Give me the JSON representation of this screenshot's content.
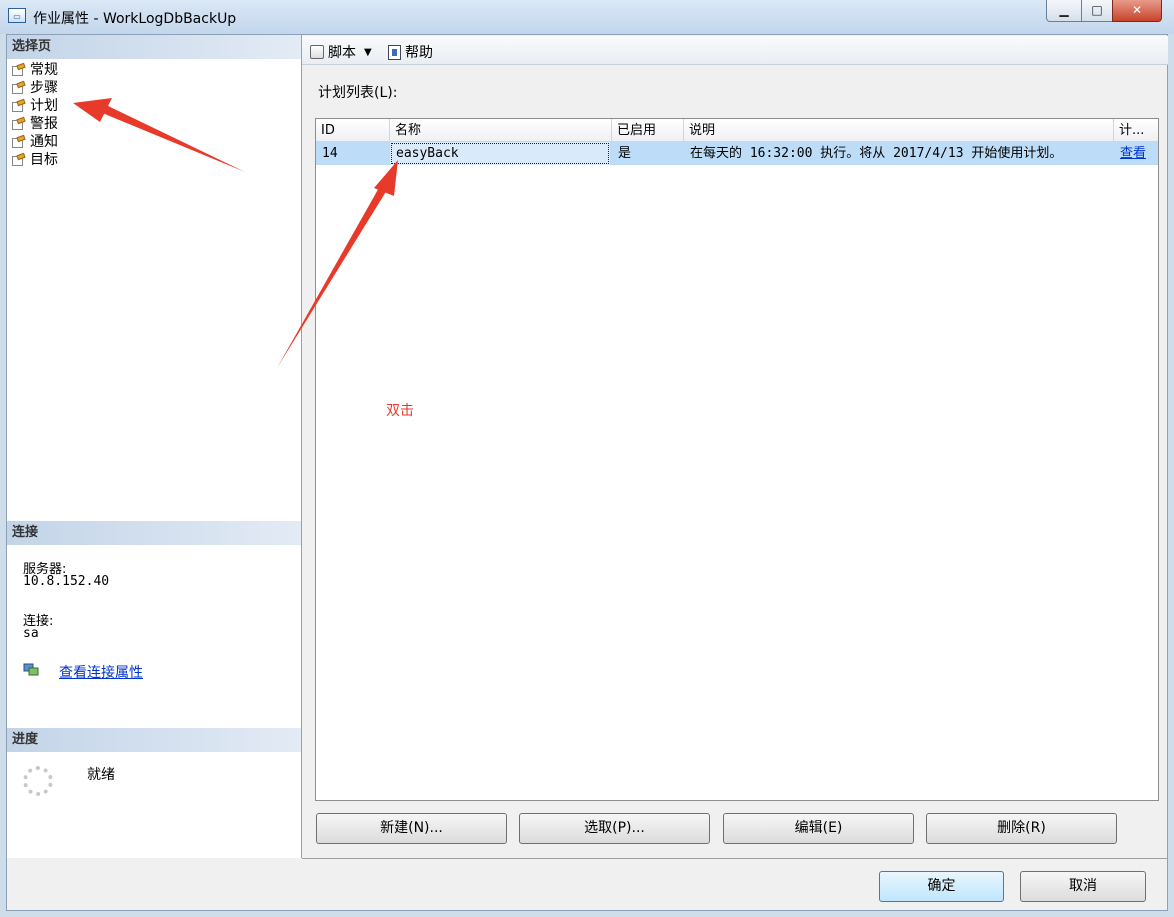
{
  "window": {
    "title": "作业属性 - WorkLogDbBackUp",
    "app_icon": "job-properties-icon"
  },
  "sidebar": {
    "header": "选择页",
    "items": [
      {
        "label": "常规",
        "icon": "page-icon"
      },
      {
        "label": "步骤",
        "icon": "page-icon"
      },
      {
        "label": "计划",
        "icon": "page-icon"
      },
      {
        "label": "警报",
        "icon": "page-icon"
      },
      {
        "label": "通知",
        "icon": "page-icon"
      },
      {
        "label": "目标",
        "icon": "page-icon"
      }
    ]
  },
  "connection": {
    "header": "连接",
    "server_label": "服务器:",
    "server_value": "10.8.152.40",
    "connection_label": "连接:",
    "connection_value": "sa",
    "view_properties_link": "查看连接属性"
  },
  "progress": {
    "header": "进度",
    "status": "就绪"
  },
  "toolbar": {
    "script_label": "脚本",
    "help_label": "帮助"
  },
  "schedule": {
    "list_label": "计划列表(L):",
    "columns": [
      "ID",
      "名称",
      "已启用",
      "说明",
      "计..."
    ],
    "rows": [
      {
        "id": "14",
        "name": "easyBack",
        "enabled": "是",
        "description": "在每天的 16:32:00 执行。将从 2017/4/13 开始使用计划。",
        "action": "查看"
      }
    ]
  },
  "buttons": {
    "new": "新建(N)...",
    "pick": "选取(P)...",
    "edit": "编辑(E)",
    "delete": "删除(R)",
    "ok": "确定",
    "cancel": "取消"
  },
  "annotation": {
    "text": "双击",
    "color": "#e83a2a"
  },
  "colors": {
    "selected_row": "#bcdcf7",
    "link": "#0033cc",
    "section_header": "#c3d4e8"
  }
}
